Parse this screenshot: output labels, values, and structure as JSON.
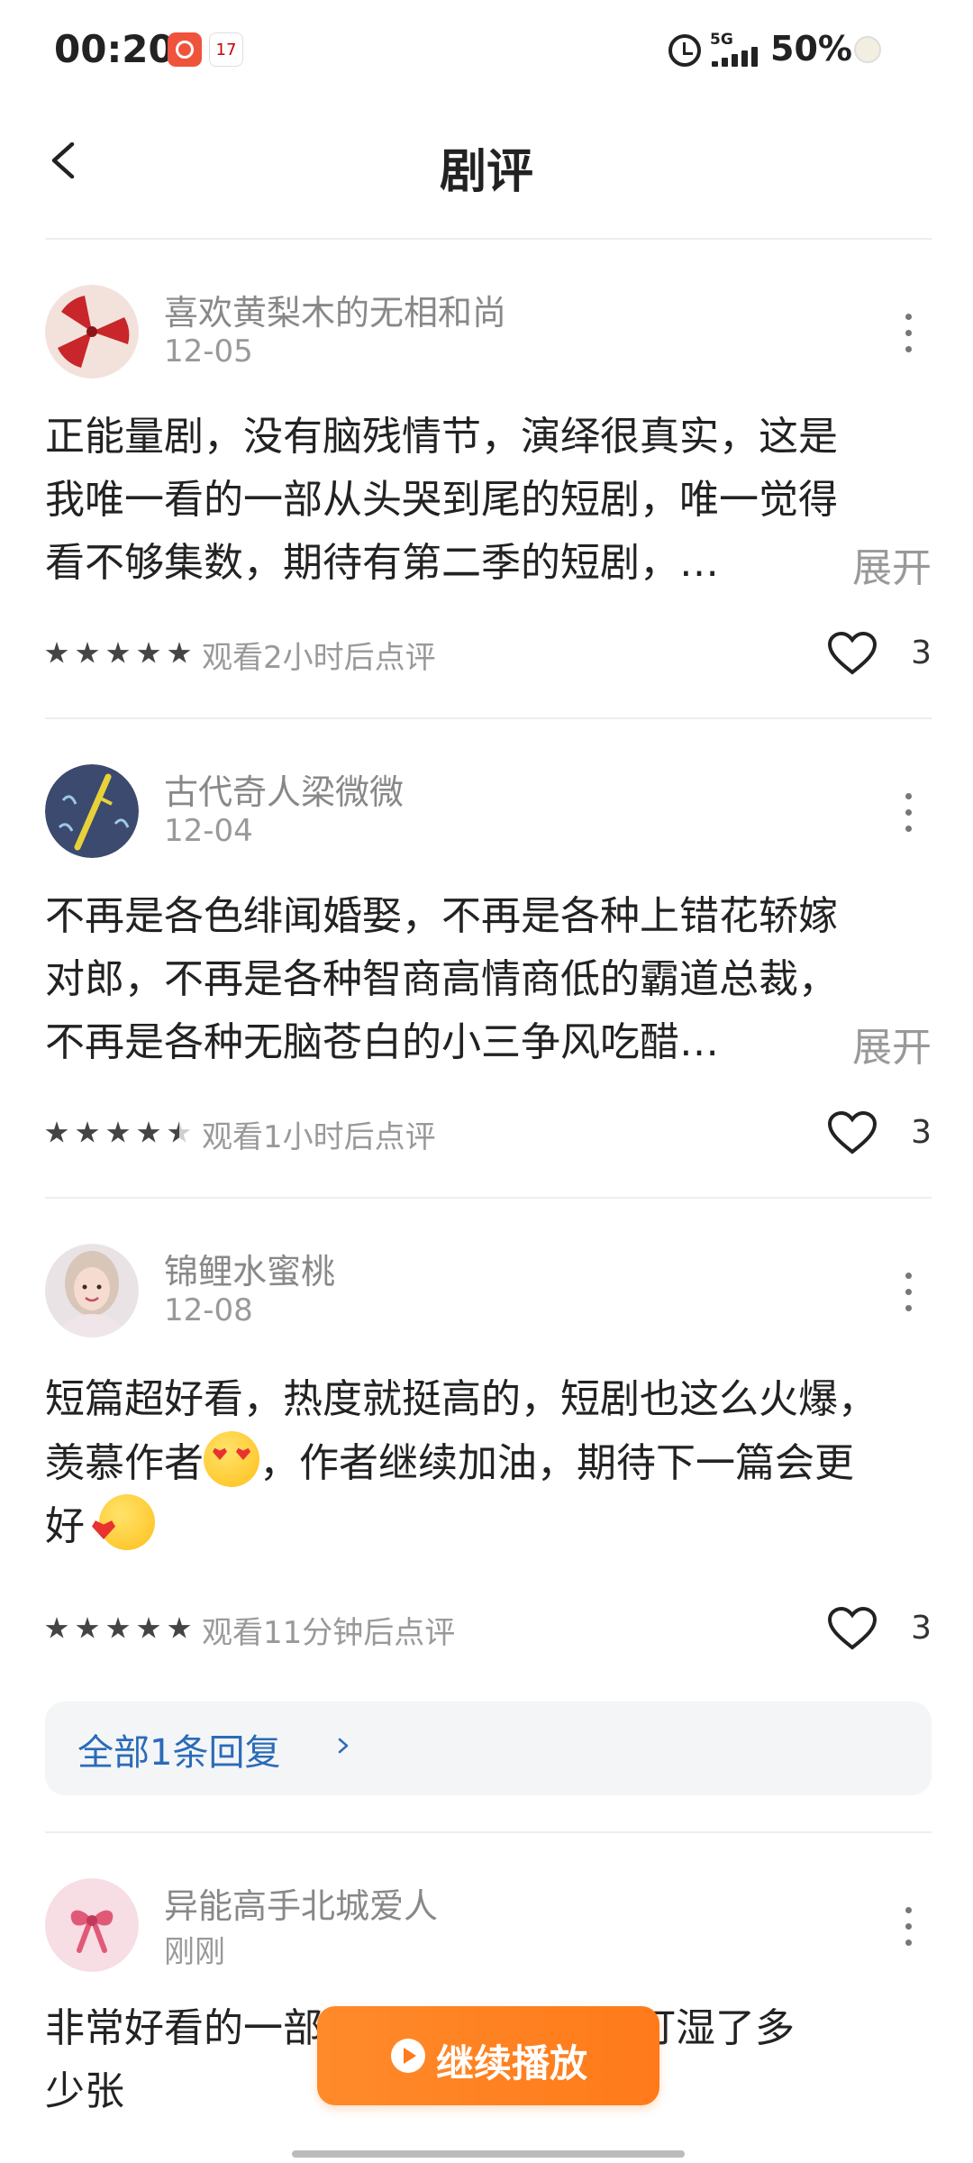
{
  "status_bar": {
    "time": "00:20",
    "calendar_day": "17",
    "network": "5G",
    "battery": "50%"
  },
  "header": {
    "title": "剧评"
  },
  "reviews": [
    {
      "username": "喜欢黄梨木的无相和尚",
      "date": "12-05",
      "lines": [
        "正能量剧，没有脑残情节，演绎很真实，这是",
        "我唯一看的一部从头哭到尾的短剧，唯一觉得",
        "看不够集数，期待有第二季的短剧，…"
      ],
      "expand_label": "展开",
      "stars": 5,
      "rating_text": "观看2小时后点评",
      "likes": "3"
    },
    {
      "username": "古代奇人梁微微",
      "date": "12-04",
      "lines": [
        "不再是各色绯闻婚娶，不再是各种上错花轿嫁",
        "对郎，不再是各种智商高情商低的霸道总裁，",
        "不再是各种无脑苍白的小三争风吃醋…"
      ],
      "expand_label": "展开",
      "stars": 4.5,
      "rating_text": "观看1小时后点评",
      "likes": "3"
    },
    {
      "username": "锦鲤水蜜桃",
      "date": "12-08",
      "lines": [
        "短篇超好看，热度就挺高的，短剧也这么火爆，",
        "羡慕作者",
        "，作者继续加油，期待下一篇会更",
        "好"
      ],
      "stars": 5,
      "rating_text": "观看11分钟后点评",
      "likes": "3",
      "replies_label": "全部1条回复"
    },
    {
      "username": "异能高手北城爱人",
      "date": "刚刚",
      "lines": [
        "非常好看的一部",
        "知道打湿了多",
        "少张"
      ]
    }
  ],
  "continue_button": {
    "label": "继续播放"
  },
  "colors": {
    "accent": "#ff7a1a",
    "link": "#2a6bb8",
    "text": "#222222",
    "muted": "#999999"
  }
}
